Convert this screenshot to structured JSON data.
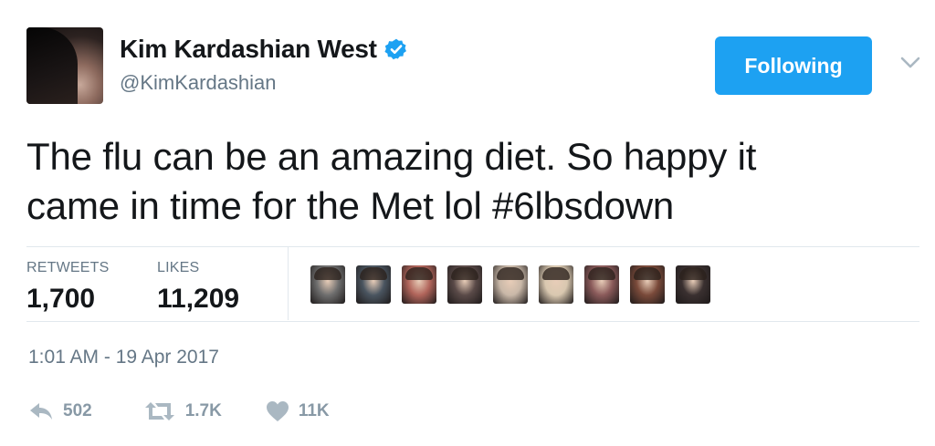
{
  "author": {
    "name": "Kim Kardashian West",
    "handle": "@KimKardashian",
    "verified": true
  },
  "follow_button": {
    "label": "Following",
    "color": "#1da1f2"
  },
  "tweet": {
    "text_line1": "The flu can be an amazing diet. So happy it",
    "text_line2": "came in time for the Met lol #6lbsdown"
  },
  "stats": {
    "retweets_label": "RETWEETS",
    "retweets_value": "1,700",
    "likes_label": "LIKES",
    "likes_value": "11,209"
  },
  "liker_avatars": [
    {
      "icon": "liker-avatar-1",
      "tone": "#6e6e6e"
    },
    {
      "icon": "liker-avatar-2",
      "tone": "#4a5560"
    },
    {
      "icon": "liker-avatar-3",
      "tone": "#b0645a"
    },
    {
      "icon": "liker-avatar-4",
      "tone": "#5a4a48"
    },
    {
      "icon": "liker-avatar-5",
      "tone": "#c9b8a8"
    },
    {
      "icon": "liker-avatar-6",
      "tone": "#d9c8b0"
    },
    {
      "icon": "liker-avatar-7",
      "tone": "#8a5a5a"
    },
    {
      "icon": "liker-avatar-8",
      "tone": "#7a4a3a"
    },
    {
      "icon": "liker-avatar-9",
      "tone": "#3a3030"
    }
  ],
  "timestamp": "1:01 AM - 19 Apr 2017",
  "actions": {
    "reply_count": "502",
    "retweet_count": "1.7K",
    "like_count": "11K"
  },
  "colors": {
    "secondary_text": "#657786",
    "action_icon": "#aab8c2",
    "divider": "#e1e8ed"
  }
}
